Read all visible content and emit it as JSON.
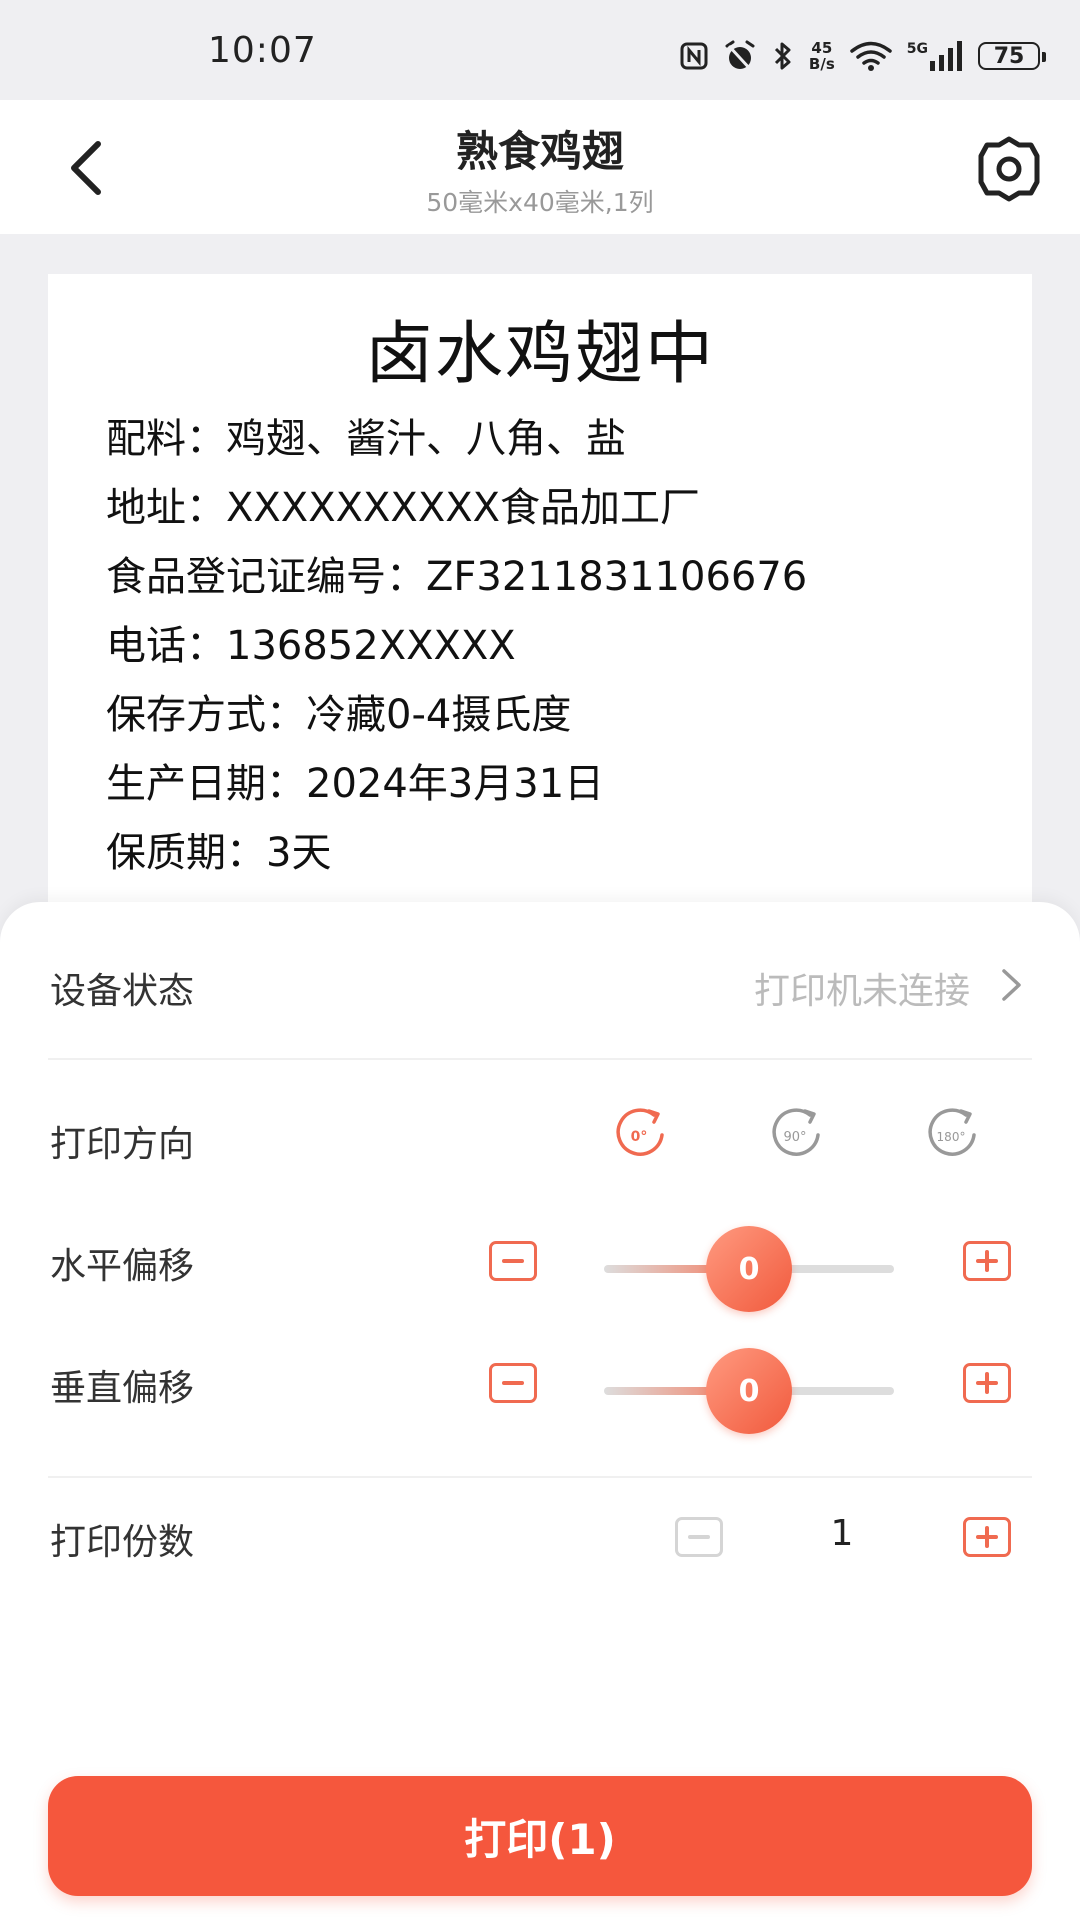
{
  "status_bar": {
    "time": "10:07",
    "net_speed_value": "45",
    "net_speed_unit": "B/s",
    "network_label": "5G",
    "battery": "75"
  },
  "header": {
    "title": "熟食鸡翅",
    "subtitle": "50毫米x40毫米,1列",
    "back_icon": "chevron-left-icon",
    "settings_icon": "gear-icon"
  },
  "label": {
    "title": "卤水鸡翅中",
    "lines": [
      "配料：鸡翅、酱汁、八角、盐",
      "地址：XXXXXXXXXX食品加工厂",
      "食品登记证编号：ZF3211831106676",
      "电话：136852XXXXX",
      "保存方式：冷藏0-4摄氏度",
      "生产日期：2024年3月31日",
      "保质期：3天"
    ]
  },
  "settings": {
    "device_status": {
      "label": "设备状态",
      "value": "打印机未连接"
    },
    "print_direction": {
      "label": "打印方向",
      "options": [
        "0°",
        "90°",
        "180°"
      ],
      "selected": "0°"
    },
    "horizontal_offset": {
      "label": "水平偏移",
      "value": "0",
      "fill_fraction": 0.5
    },
    "vertical_offset": {
      "label": "垂直偏移",
      "value": "0",
      "fill_fraction": 0.5
    },
    "copies": {
      "label": "打印份数",
      "value": "1"
    }
  },
  "print_button": {
    "label": "打印(1)"
  },
  "colors": {
    "accent": "#f5573d",
    "muted": "#bbbbbb",
    "background": "#efeff2"
  }
}
